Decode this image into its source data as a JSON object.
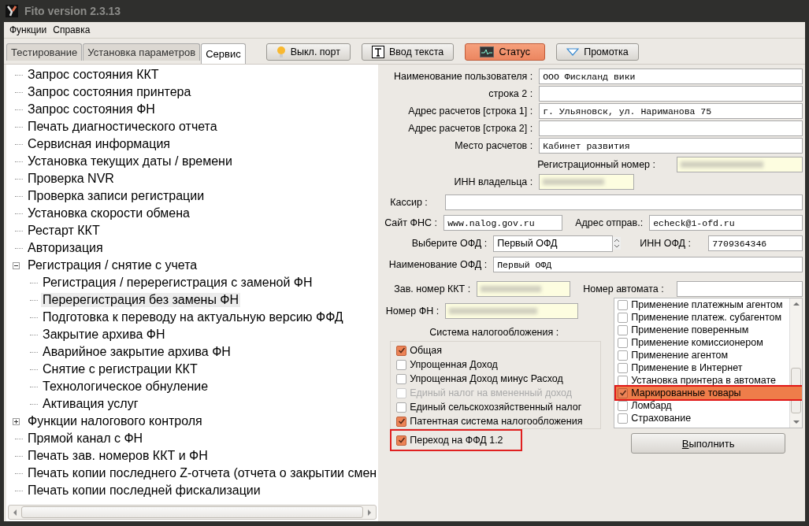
{
  "window": {
    "title": "Fito version 2.3.13"
  },
  "menu": [
    "Функции",
    "Справка"
  ],
  "tabs": [
    {
      "label": "Тестирование",
      "selected": false
    },
    {
      "label": "Установка параметров",
      "selected": false
    },
    {
      "label": "Сервис",
      "selected": true
    }
  ],
  "toolbar": [
    {
      "label": "Выкл. порт",
      "kind": "port",
      "selected": false
    },
    {
      "label": "Ввод текста",
      "kind": "text",
      "selected": false
    },
    {
      "label": "Статус",
      "kind": "status",
      "selected": true
    },
    {
      "label": "Промотка",
      "kind": "feed",
      "selected": false
    }
  ],
  "tree": [
    {
      "label": "Запрос состояния ККТ",
      "selected": false
    },
    {
      "label": "Запрос состояния принтера",
      "selected": false
    },
    {
      "label": "Запрос состояния ФН",
      "selected": false
    },
    {
      "label": "Печать диагностического отчета",
      "selected": false
    },
    {
      "label": "Сервисная информация",
      "selected": false
    },
    {
      "label": "Установка текущих даты / времени",
      "selected": false
    },
    {
      "label": "Проверка NVR",
      "selected": false
    },
    {
      "label": "Проверка записи регистрации",
      "selected": false
    },
    {
      "label": "Установка скорости обмена",
      "selected": false
    },
    {
      "label": "Рестарт ККТ",
      "selected": false
    },
    {
      "label": "Авторизация",
      "selected": false
    },
    {
      "label": "Регистрация / снятие с учета",
      "selected": false,
      "expanded": true,
      "children": [
        {
          "label": "Регистрация / перерегистрация с заменой ФН",
          "selected": false
        },
        {
          "label": "Перерегистрация без замены ФН",
          "selected": true
        },
        {
          "label": "Подготовка к переводу на актуальную версию ФФД",
          "selected": false
        },
        {
          "label": "Закрытие архива ФН",
          "selected": false
        },
        {
          "label": "Аварийное закрытие архива ФН",
          "selected": false
        },
        {
          "label": "Снятие с регистрации ККТ",
          "selected": false
        },
        {
          "label": "Технологическое обнуление",
          "selected": false
        },
        {
          "label": "Активация услуг",
          "selected": false
        }
      ]
    },
    {
      "label": "Функции налогового контроля",
      "selected": false,
      "expanded": false
    },
    {
      "label": "Прямой канал с ФН",
      "selected": false
    },
    {
      "label": "Печать зав. номеров ККТ и ФН",
      "selected": false
    },
    {
      "label": "Печать копии последнего Z-отчета (отчета о закрытии смен",
      "selected": false
    },
    {
      "label": "Печать копии последней фискализации",
      "selected": false
    }
  ],
  "form": {
    "user_name": {
      "label": "Наименование пользователя :",
      "value": "ООО Фискланд вики"
    },
    "line_2": {
      "label": "строка 2 :"
    },
    "address_1": {
      "label": "Адрес расчетов [строка 1] :",
      "value": "г. Ульяновск, ул. Нариманова 75"
    },
    "address_2": {
      "label": "Адрес расчетов [строка 2] :"
    },
    "place": {
      "label": "Место расчетов :",
      "value": "Кабинет развития"
    },
    "reg_number": {
      "label": "Регистрационный номер :",
      "redacted": true
    },
    "owner_inn": {
      "label": "ИНН владельца :",
      "redacted": true
    },
    "cashier": {
      "label": "Кассир  :"
    },
    "fns_site": {
      "label": "Сайт ФНС :",
      "value": "www.nalog.gov.ru"
    },
    "sender_address": {
      "label": "Адрес отправ.:",
      "value": "echeck@1-ofd.ru"
    },
    "ofd_select": {
      "label": "Выберите ОФД :",
      "value": "Первый ОФД"
    },
    "ofd_inn": {
      "label": "ИНН ОФД :",
      "value": "7709364346"
    },
    "ofd_name": {
      "label": "Наименование ОФД :",
      "value": "Первый ОФД"
    },
    "kkt_serial": {
      "label": "Зав. номер ККТ :",
      "redacted": true
    },
    "machine_number": {
      "label": "Номер автомата :"
    },
    "fn_number": {
      "label": "Номер ФН :",
      "redacted": true
    }
  },
  "tax_system": {
    "label": "Система  налогообложения :",
    "options": [
      {
        "label": "Общая",
        "checked": true,
        "disabled": false
      },
      {
        "label": "Упрощенная Доход",
        "checked": false,
        "disabled": false
      },
      {
        "label": "Упрощенная Доход минус Расход",
        "checked": false,
        "disabled": false
      },
      {
        "label": "Единый налог на вмененный доход",
        "checked": false,
        "disabled": true
      },
      {
        "label": "Единый сельскохозяйственный налог",
        "checked": false,
        "disabled": false
      },
      {
        "label": "Патентная система налогообложения",
        "checked": true,
        "disabled": false
      }
    ]
  },
  "ffd_transition": {
    "label": "Переход на ФФД  1.2",
    "checked": true,
    "highlighted": true
  },
  "attributes": [
    {
      "label": "Применение платежным агентом",
      "checked": false,
      "selected": false,
      "highlighted": false
    },
    {
      "label": "Применение платеж. субагентом",
      "checked": false,
      "selected": false,
      "highlighted": false
    },
    {
      "label": "Применение поверенным",
      "checked": false,
      "selected": false,
      "highlighted": false
    },
    {
      "label": "Применение комиссионером",
      "checked": false,
      "selected": false,
      "highlighted": false
    },
    {
      "label": "Применение агентом",
      "checked": false,
      "selected": false,
      "highlighted": false
    },
    {
      "label": "Применение в Интернет",
      "checked": false,
      "selected": false,
      "highlighted": false
    },
    {
      "label": "Установка принтера в автомате",
      "checked": false,
      "selected": false,
      "highlighted": false
    },
    {
      "label": "Маркированные товары",
      "checked": true,
      "selected": true,
      "highlighted": true
    },
    {
      "label": "Ломбард",
      "checked": false,
      "selected": false,
      "highlighted": false
    },
    {
      "label": "Страхование",
      "checked": false,
      "selected": false,
      "highlighted": false
    }
  ],
  "execute_button": {
    "label": "Выполнить"
  }
}
